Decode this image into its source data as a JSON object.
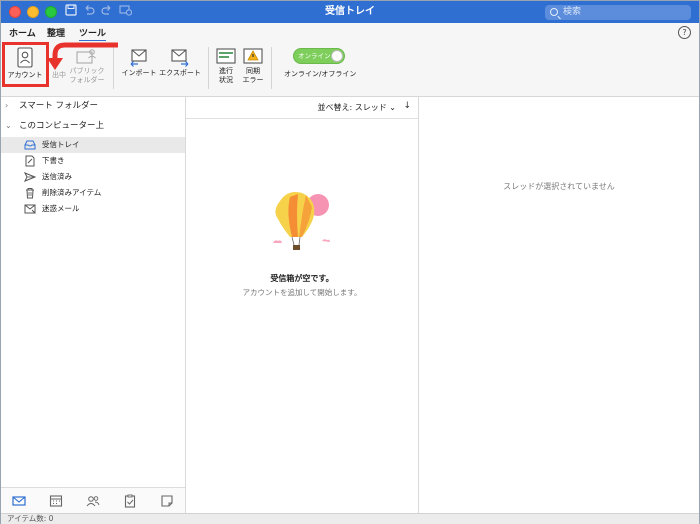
{
  "window": {
    "title": "受信トレイ",
    "search_placeholder": "検索"
  },
  "ribbon_tabs": [
    {
      "label": "ホーム"
    },
    {
      "label": "整理"
    },
    {
      "label": "ツール",
      "active": true
    }
  ],
  "ribbon": {
    "account": "アカウント",
    "out_of_office": "出中",
    "public_folder_line1": "パブリック",
    "public_folder_line2": "フォルダー",
    "import": "インポート",
    "export": "エクスポート",
    "progress_line1": "進行",
    "progress_line2": "状況",
    "sync_line1": "同期",
    "sync_line2": "エラー",
    "online_toggle_text": "オンライン",
    "online_offline": "オンライン/オフライン"
  },
  "sidebar": {
    "smart_folders": "スマート フォルダー",
    "this_computer": "このコンピューター上",
    "items": [
      {
        "label": "受信トレイ",
        "icon": "inbox-icon",
        "selected": true
      },
      {
        "label": "下書き",
        "icon": "draft-icon"
      },
      {
        "label": "送信済み",
        "icon": "sent-icon"
      },
      {
        "label": "削除済みアイテム",
        "icon": "trash-icon"
      },
      {
        "label": "迷惑メール",
        "icon": "junk-icon"
      }
    ]
  },
  "list": {
    "sort_label": "並べ替え: スレッド",
    "empty_title": "受信箱が空です。",
    "empty_subtitle": "アカウントを追加して開始します。"
  },
  "reading": {
    "no_thread": "スレッドが選択されていません"
  },
  "status": {
    "item_count": "アイテム数: 0"
  },
  "colors": {
    "titlebar": "#2f6fd2",
    "annotation": "#e8332d",
    "toggle_on": "#7dce5b"
  }
}
